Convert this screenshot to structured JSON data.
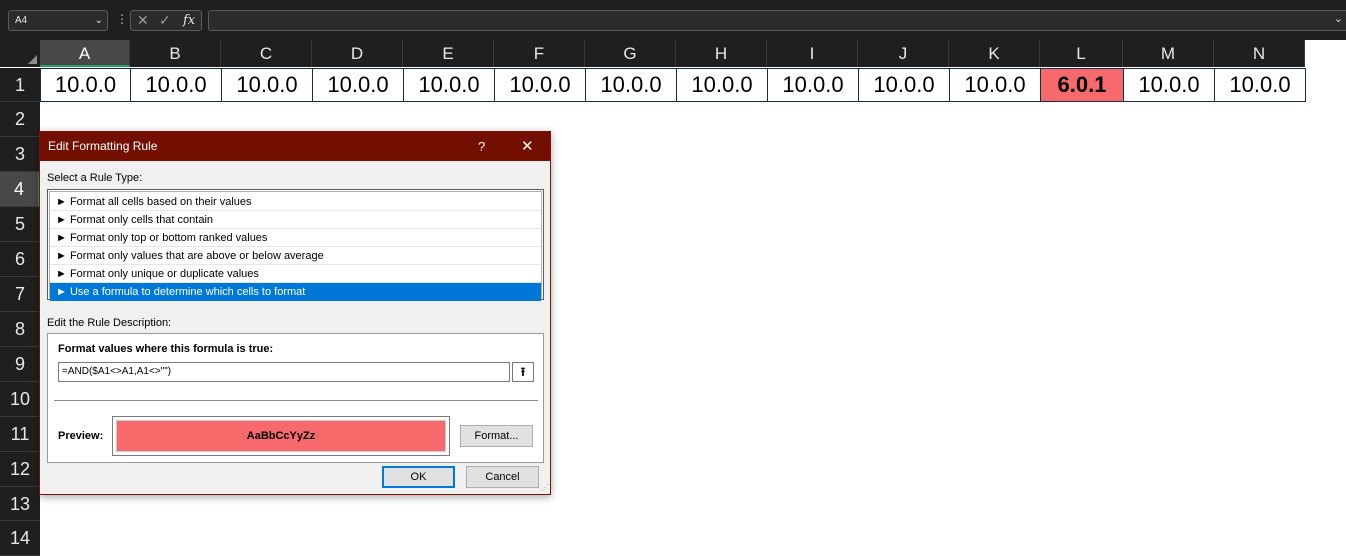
{
  "formula_bar": {
    "name_box": "A4",
    "name_box_chevron": "⌄",
    "menu_dots": "⋮",
    "cancel_icon": "✕",
    "enter_icon": "✓",
    "fx_label": "fx",
    "formula_value": "",
    "expand_chevron": "⌄"
  },
  "columns": [
    "A",
    "B",
    "C",
    "D",
    "E",
    "F",
    "G",
    "H",
    "I",
    "J",
    "K",
    "L",
    "M",
    "N"
  ],
  "rows": [
    "1",
    "2",
    "3",
    "4",
    "5",
    "6",
    "7",
    "8",
    "9",
    "10",
    "11",
    "12",
    "13",
    "14"
  ],
  "selected_row": "4",
  "row1_values": [
    "10.0.0",
    "10.0.0",
    "10.0.0",
    "10.0.0",
    "10.0.0",
    "10.0.0",
    "10.0.0",
    "10.0.0",
    "10.0.0",
    "10.0.0",
    "10.0.0",
    "6.0.1",
    "10.0.0",
    "10.0.0"
  ],
  "highlight_color": "#f8696b",
  "dialog": {
    "title": "Edit Formatting Rule",
    "help_label": "?",
    "close_label": "✕",
    "select_rule_type_label": "Select a Rule Type:",
    "rule_types": [
      "► Format all cells based on their values",
      "► Format only cells that contain",
      "► Format only top or bottom ranked values",
      "► Format only values that are above or below average",
      "► Format only unique or duplicate values",
      "► Use a formula to determine which cells to format"
    ],
    "selected_rule_index": 5,
    "edit_description_label": "Edit the Rule Description:",
    "formula_label": "Format values where this formula is true:",
    "formula": "=AND($A1<>A1,A1<>\"\")",
    "collapse_icon": "⭱",
    "preview_label": "Preview:",
    "preview_text": "AaBbCcYyZz",
    "format_button": "Format...",
    "ok_button": "OK",
    "cancel_button": "Cancel"
  }
}
